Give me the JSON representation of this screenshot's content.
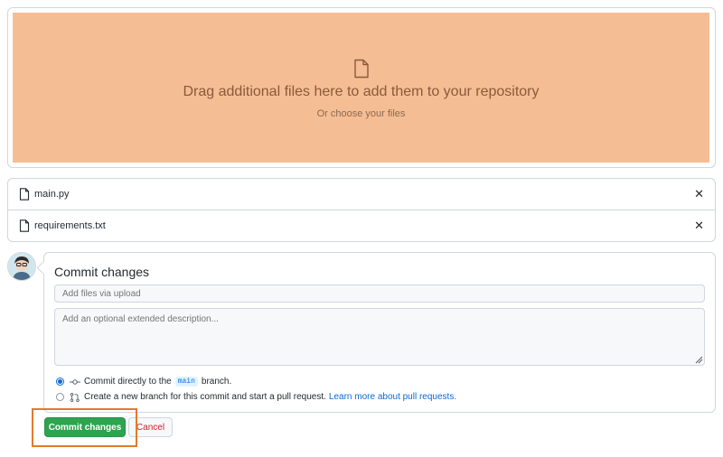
{
  "dropzone": {
    "title": "Drag additional files here to add them to your repository",
    "subtitle": "Or choose your files",
    "icon": "file-icon",
    "background": "#f5bd93"
  },
  "files": [
    {
      "name": "main.py",
      "icon": "file-icon"
    },
    {
      "name": "requirements.txt",
      "icon": "file-icon"
    }
  ],
  "commit": {
    "title": "Commit changes",
    "summary_placeholder": "Add files via upload",
    "description_placeholder": "Add an optional extended description...",
    "option_direct": {
      "prefix": "Commit directly to the",
      "branch": "main",
      "suffix": "branch.",
      "selected": true
    },
    "option_new_branch": {
      "text": "Create a new branch for this commit and start a pull request.",
      "link": "Learn more about pull requests.",
      "selected": false
    }
  },
  "buttons": {
    "commit": "Commit changes",
    "cancel": "Cancel"
  },
  "colors": {
    "primary_button": "#2da44e",
    "cancel_text": "#cf222e",
    "link": "#0969da",
    "highlight": "#e07b2a"
  }
}
